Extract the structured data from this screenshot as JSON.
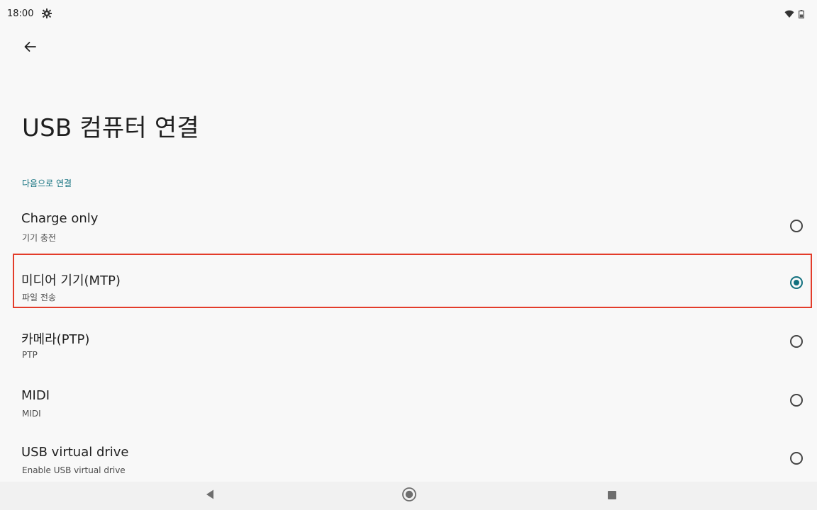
{
  "status_bar": {
    "time": "18:00",
    "left_icon": "gear-icon",
    "right_icons": [
      "wifi-icon",
      "battery-icon"
    ]
  },
  "header": {
    "back_icon": "back-arrow-icon",
    "title": "USB 컴퓨터 연결"
  },
  "section": {
    "label": "다음으로 연결"
  },
  "options": [
    {
      "title": "Charge only",
      "summary": "기기 충전",
      "selected": false
    },
    {
      "title": "미디어 기기(MTP)",
      "summary": "파일 전송",
      "selected": true
    },
    {
      "title": "카메라(PTP)",
      "summary": "PTP",
      "selected": false
    },
    {
      "title": "MIDI",
      "summary": "MIDI",
      "selected": false
    },
    {
      "title": "USB virtual drive",
      "summary": "Enable USB virtual drive",
      "selected": false
    }
  ],
  "nav_bar": {
    "back_icon": "nav-back-icon",
    "home_icon": "nav-home-icon",
    "recents_icon": "nav-recents-icon"
  },
  "colors": {
    "accent": "#11707e",
    "highlight": "#e33c2a",
    "background": "#f8f8f8"
  }
}
